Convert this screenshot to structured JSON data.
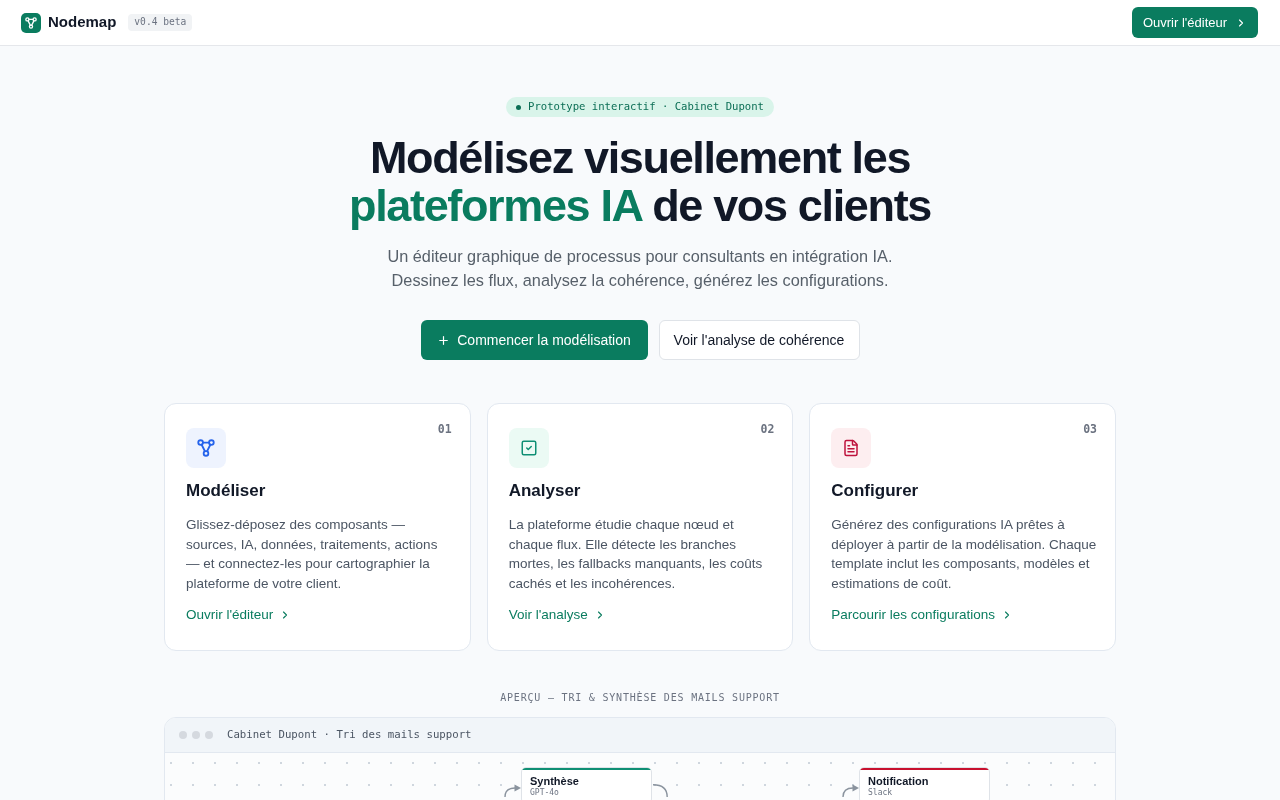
{
  "header": {
    "logo": "Nodemap",
    "version": "v0.4 beta",
    "button": "Ouvrir l'éditeur"
  },
  "hero": {
    "badge": "Prototype interactif · Cabinet Dupont",
    "title": {
      "line_1": "Modélisez visuellement les",
      "highlight": "plateformes IA",
      "rest": "de vos clients"
    },
    "subtitle_lines": [
      "Un éditeur graphique de processus pour consultants en intégration IA.",
      "Dessinez les flux, analysez la cohérence, générez les configurations."
    ],
    "buttons": [
      {
        "label": "Commencer la modélisation",
        "kind": "primary"
      },
      {
        "label": "Voir l'analyse de cohérence",
        "kind": "secondary"
      }
    ]
  },
  "features": [
    {
      "kind": "model",
      "number": "01",
      "title": "Modéliser",
      "description": "Glissez-déposez des composants — sources, IA, données, traitements, actions — et connectez-les pour cartographier la plateforme de votre client.",
      "link": "Ouvrir l'éditeur"
    },
    {
      "kind": "analyze",
      "number": "02",
      "title": "Analyser",
      "description": "La plateforme étudie chaque nœud et chaque flux. Elle détecte les branches mortes, les fallbacks manquants, les coûts cachés et les incohérences.",
      "link": "Voir l'analyse"
    },
    {
      "kind": "configure",
      "number": "03",
      "title": "Configurer",
      "description": "Générez des configurations IA prêtes à déployer à partir de la modélisation. Chaque template inclut les composants, modèles et estimations de coût.",
      "link": "Parcourir les configurations"
    }
  ],
  "preview": {
    "label": "APERÇU — TRI & SYNTHÈSE DES MAILS SUPPORT",
    "window_title": "Cabinet Dupont · Tri des mails support",
    "nodes": [
      {
        "title": "Synthèse",
        "subtitle": "GPT-4o",
        "color": "#0f8f74"
      },
      {
        "title": "Notification",
        "subtitle": "Slack",
        "color": "#c8102e"
      }
    ]
  }
}
